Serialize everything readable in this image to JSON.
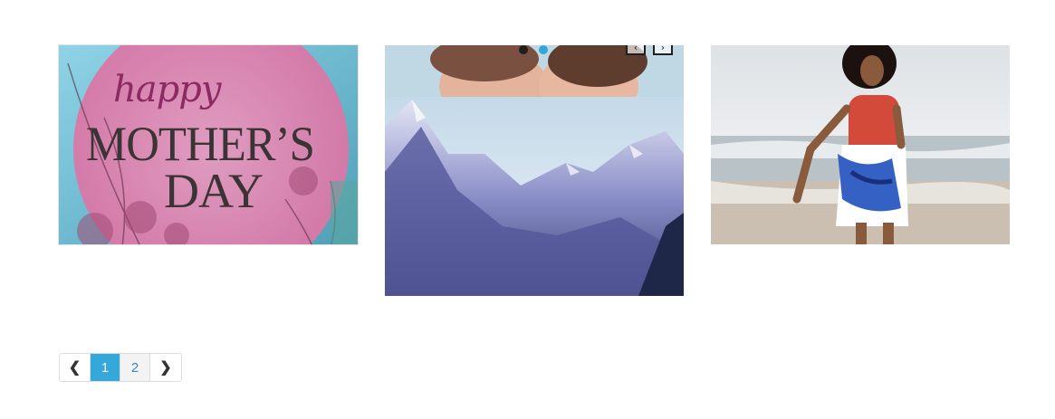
{
  "cards": [
    {
      "name": "mothers-day",
      "happy_text": "happy",
      "mothers_text": "MOTHER’S",
      "day_text": "DAY"
    },
    {
      "name": "mountains-slider",
      "prev_glyph": "‹",
      "next_glyph": "›"
    },
    {
      "name": "beach-woman"
    }
  ],
  "pagination": {
    "prev_glyph": "❮",
    "next_glyph": "❯",
    "pages": [
      "1",
      "2"
    ],
    "current_page": "1"
  },
  "colors": {
    "accent": "#34a7db",
    "dot_active": "#1f1f1f",
    "dot_inactive": "#2ea7d9"
  }
}
